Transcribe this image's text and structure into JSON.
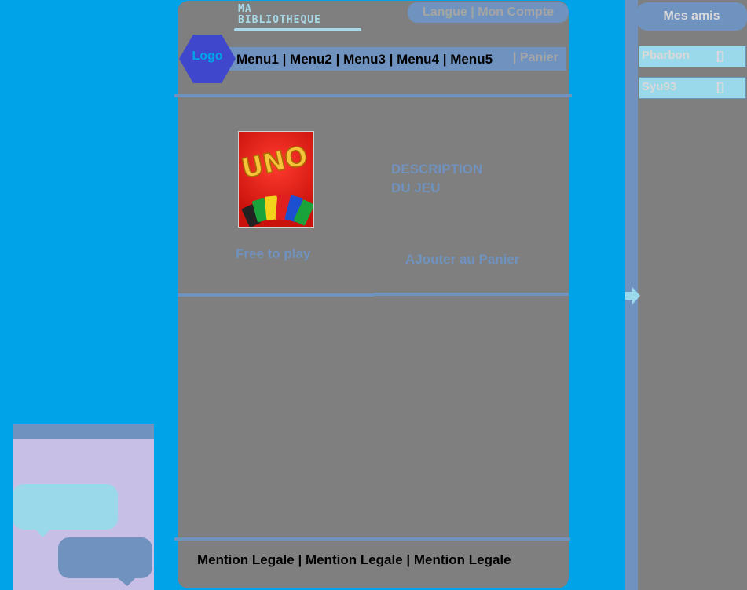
{
  "header": {
    "site_title_line1": "MA",
    "site_title_line2": "BIBLIOTHEQUE",
    "top_links": {
      "language": "Langue",
      "separator": " | ",
      "account": "Mon Compte"
    },
    "logo_label": "Logo"
  },
  "nav": {
    "menus": [
      "Menu1",
      "Menu2",
      "Menu3",
      "Menu4",
      "Menu5"
    ],
    "separator": " | ",
    "cart_label": "| Panier"
  },
  "game": {
    "image_icon": "uno-card-icon",
    "image_text": "UNO",
    "price_label": "Free to play",
    "description_line1": "DESCRIPTION",
    "description_line2": "DU JEU",
    "add_to_cart_label": "AJouter au Panier"
  },
  "footer": {
    "legal_links": [
      "Mention Legale",
      "Mention Legale",
      "Mention Legale"
    ],
    "separator": " | "
  },
  "sidebar": {
    "title": "Mes amis",
    "friends": [
      {
        "name": "Pbarbon",
        "status": "[]"
      },
      {
        "name": "Syu93",
        "status": "[]"
      }
    ],
    "expand_icon": "arrow-right-icon"
  },
  "chat": {
    "icon_left": "speech-bubble-icon",
    "icon_right": "speech-bubble-icon"
  },
  "colors": {
    "background": "#00a2e8",
    "panel": "#7f7f7f",
    "accent": "#7092be",
    "logo": "#3f48cc",
    "light_accent": "#99d9ea",
    "chat_bg": "#c8bfe7"
  }
}
